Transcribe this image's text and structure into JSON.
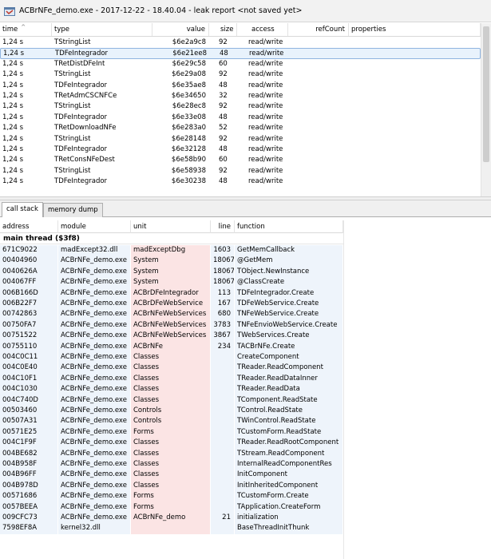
{
  "window": {
    "title": "ACBrNFe_demo.exe - 2017-12-22 - 18.40.04 - leak report  <not saved yet>"
  },
  "leak_table": {
    "columns": [
      "time",
      "type",
      "value",
      "size",
      "access",
      "refCount",
      "properties"
    ],
    "rows": [
      {
        "time": "1,24 s",
        "type": "TStringList",
        "value": "$6e2a9c8",
        "size": "92",
        "access": "read/write",
        "refCount": "",
        "properties": ""
      },
      {
        "time": "1,24 s",
        "type": "TDFeIntegrador",
        "value": "$6e21ee8",
        "size": "48",
        "access": "read/write",
        "refCount": "",
        "properties": ""
      },
      {
        "time": "1,24 s",
        "type": "TRetDistDFeInt",
        "value": "$6e29c58",
        "size": "60",
        "access": "read/write",
        "refCount": "",
        "properties": ""
      },
      {
        "time": "1,24 s",
        "type": "TStringList",
        "value": "$6e29a08",
        "size": "92",
        "access": "read/write",
        "refCount": "",
        "properties": ""
      },
      {
        "time": "1,24 s",
        "type": "TDFeIntegrador",
        "value": "$6e35ae8",
        "size": "48",
        "access": "read/write",
        "refCount": "",
        "properties": ""
      },
      {
        "time": "1,24 s",
        "type": "TRetAdmCSCNFCe",
        "value": "$6e34650",
        "size": "32",
        "access": "read/write",
        "refCount": "",
        "properties": ""
      },
      {
        "time": "1,24 s",
        "type": "TStringList",
        "value": "$6e28ec8",
        "size": "92",
        "access": "read/write",
        "refCount": "",
        "properties": ""
      },
      {
        "time": "1,24 s",
        "type": "TDFeIntegrador",
        "value": "$6e33e08",
        "size": "48",
        "access": "read/write",
        "refCount": "",
        "properties": ""
      },
      {
        "time": "1,24 s",
        "type": "TRetDownloadNFe",
        "value": "$6e283a0",
        "size": "52",
        "access": "read/write",
        "refCount": "",
        "properties": ""
      },
      {
        "time": "1,24 s",
        "type": "TStringList",
        "value": "$6e28148",
        "size": "92",
        "access": "read/write",
        "refCount": "",
        "properties": ""
      },
      {
        "time": "1,24 s",
        "type": "TDFeIntegrador",
        "value": "$6e32128",
        "size": "48",
        "access": "read/write",
        "refCount": "",
        "properties": ""
      },
      {
        "time": "1,24 s",
        "type": "TRetConsNFeDest",
        "value": "$6e58b90",
        "size": "60",
        "access": "read/write",
        "refCount": "",
        "properties": ""
      },
      {
        "time": "1,24 s",
        "type": "TStringList",
        "value": "$6e58938",
        "size": "92",
        "access": "read/write",
        "refCount": "",
        "properties": ""
      },
      {
        "time": "1,24 s",
        "type": "TDFeIntegrador",
        "value": "$6e30238",
        "size": "48",
        "access": "read/write",
        "refCount": "",
        "properties": ""
      }
    ],
    "selected_index": 1
  },
  "tabs": [
    {
      "label": "call stack",
      "active": true
    },
    {
      "label": "memory dump",
      "active": false
    }
  ],
  "call_stack": {
    "columns": [
      "address",
      "module",
      "unit",
      "line",
      "function"
    ],
    "thread_title": "main thread ($3f8)",
    "rows": [
      {
        "address": "671C9022",
        "module": "madExcept32.dll",
        "unit": "madExceptDbg",
        "line": "1603",
        "function": "GetMemCallback",
        "hl": "red"
      },
      {
        "address": "00404960",
        "module": "ACBrNFe_demo.exe",
        "unit": "System",
        "line": "18067",
        "function": "@GetMem",
        "hl": "red"
      },
      {
        "address": "0040626A",
        "module": "ACBrNFe_demo.exe",
        "unit": "System",
        "line": "18067",
        "function": "TObject.NewInstance",
        "hl": "red"
      },
      {
        "address": "004067FF",
        "module": "ACBrNFe_demo.exe",
        "unit": "System",
        "line": "18067",
        "function": "@ClassCreate",
        "hl": "red"
      },
      {
        "address": "006B166D",
        "module": "ACBrNFe_demo.exe",
        "unit": "ACBrDFeIntegrador",
        "line": "113",
        "function": "TDFeIntegrador.Create",
        "hl": "red"
      },
      {
        "address": "006B22F7",
        "module": "ACBrNFe_demo.exe",
        "unit": "ACBrDFeWebService",
        "line": "167",
        "function": "TDFeWebService.Create",
        "hl": "red"
      },
      {
        "address": "00742863",
        "module": "ACBrNFe_demo.exe",
        "unit": "ACBrNFeWebServices",
        "line": "680",
        "function": "TNFeWebService.Create",
        "hl": "red"
      },
      {
        "address": "00750FA7",
        "module": "ACBrNFe_demo.exe",
        "unit": "ACBrNFeWebServices",
        "line": "3783",
        "function": "TNFeEnvioWebService.Create",
        "hl": "red"
      },
      {
        "address": "00751522",
        "module": "ACBrNFe_demo.exe",
        "unit": "ACBrNFeWebServices",
        "line": "3867",
        "function": "TWebServices.Create",
        "hl": "red"
      },
      {
        "address": "00755110",
        "module": "ACBrNFe_demo.exe",
        "unit": "ACBrNFe",
        "line": "234",
        "function": "TACBrNFe.Create",
        "hl": "red"
      },
      {
        "address": "004C0C11",
        "module": "ACBrNFe_demo.exe",
        "unit": "Classes",
        "line": "",
        "function": "CreateComponent",
        "hl": "red"
      },
      {
        "address": "004C0E40",
        "module": "ACBrNFe_demo.exe",
        "unit": "Classes",
        "line": "",
        "function": "TReader.ReadComponent",
        "hl": "red"
      },
      {
        "address": "004C10F1",
        "module": "ACBrNFe_demo.exe",
        "unit": "Classes",
        "line": "",
        "function": "TReader.ReadDataInner",
        "hl": "red"
      },
      {
        "address": "004C1030",
        "module": "ACBrNFe_demo.exe",
        "unit": "Classes",
        "line": "",
        "function": "TReader.ReadData",
        "hl": "red"
      },
      {
        "address": "004C740D",
        "module": "ACBrNFe_demo.exe",
        "unit": "Classes",
        "line": "",
        "function": "TComponent.ReadState",
        "hl": "red"
      },
      {
        "address": "00503460",
        "module": "ACBrNFe_demo.exe",
        "unit": "Controls",
        "line": "",
        "function": "TControl.ReadState",
        "hl": "red"
      },
      {
        "address": "00507A31",
        "module": "ACBrNFe_demo.exe",
        "unit": "Controls",
        "line": "",
        "function": "TWinControl.ReadState",
        "hl": "red"
      },
      {
        "address": "00571E25",
        "module": "ACBrNFe_demo.exe",
        "unit": "Forms",
        "line": "",
        "function": "TCustomForm.ReadState",
        "hl": "red"
      },
      {
        "address": "004C1F9F",
        "module": "ACBrNFe_demo.exe",
        "unit": "Classes",
        "line": "",
        "function": "TReader.ReadRootComponent",
        "hl": "red"
      },
      {
        "address": "004BE682",
        "module": "ACBrNFe_demo.exe",
        "unit": "Classes",
        "line": "",
        "function": "TStream.ReadComponent",
        "hl": "red"
      },
      {
        "address": "004B958F",
        "module": "ACBrNFe_demo.exe",
        "unit": "Classes",
        "line": "",
        "function": "InternalReadComponentRes",
        "hl": "red"
      },
      {
        "address": "004B96FF",
        "module": "ACBrNFe_demo.exe",
        "unit": "Classes",
        "line": "",
        "function": "InitComponent",
        "hl": "red"
      },
      {
        "address": "004B978D",
        "module": "ACBrNFe_demo.exe",
        "unit": "Classes",
        "line": "",
        "function": "InitInheritedComponent",
        "hl": "red"
      },
      {
        "address": "00571686",
        "module": "ACBrNFe_demo.exe",
        "unit": "Forms",
        "line": "",
        "function": "TCustomForm.Create",
        "hl": "red"
      },
      {
        "address": "0057BEEA",
        "module": "ACBrNFe_demo.exe",
        "unit": "Forms",
        "line": "",
        "function": "TApplication.CreateForm",
        "hl": "red"
      },
      {
        "address": "009CFC73",
        "module": "ACBrNFe_demo.exe",
        "unit": "ACBrNFe_demo",
        "line": "21",
        "function": "initialization",
        "hl": "red"
      },
      {
        "address": "7598EF8A",
        "module": "kernel32.dll",
        "unit": "",
        "line": "",
        "function": "BaseThreadInitThunk",
        "hl": "red"
      }
    ]
  },
  "colors": {
    "selection_bg": "#e8f2fc",
    "unit_highlight": "#fbe4e4",
    "column_highlight": "#eef4fb"
  }
}
